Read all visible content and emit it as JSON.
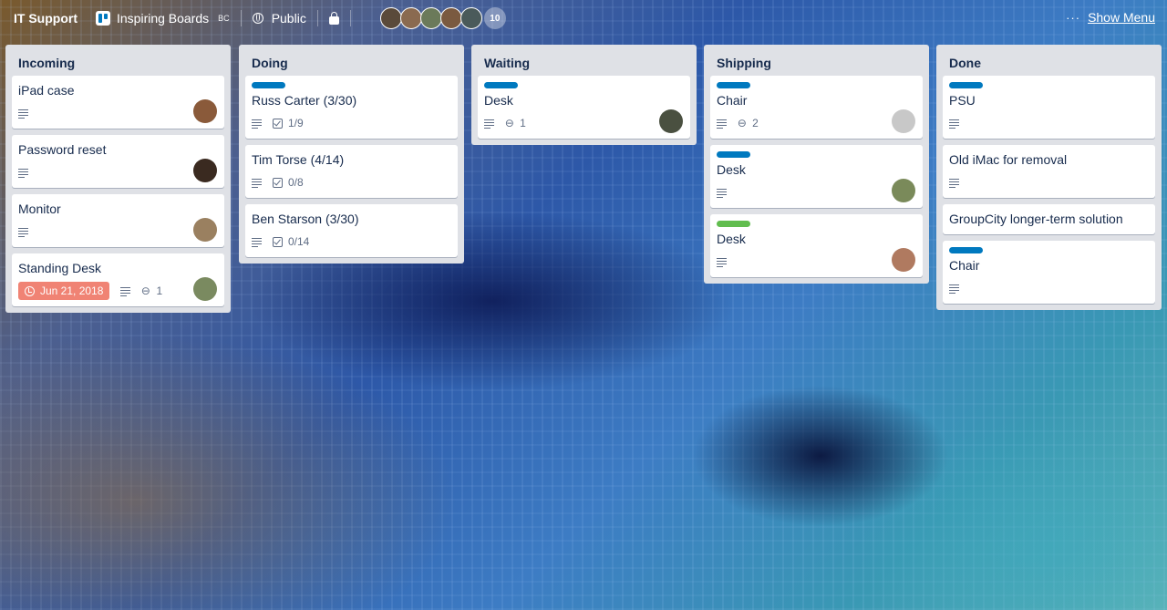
{
  "header": {
    "board_title": "IT Support",
    "org_name": "Inspiring Boards",
    "org_badge": "BC",
    "visibility": "Public",
    "member_count": "10",
    "menu_dots": "···",
    "menu_label": "Show Menu",
    "member_colors": [
      "#5a4a3a",
      "#8a6a50",
      "#6b7a5a",
      "#7a5a40",
      "#4a5a5a"
    ]
  },
  "lists": [
    {
      "name": "Incoming",
      "cards": [
        {
          "title": "iPad case",
          "avatar_color": "#8a5a3a"
        },
        {
          "title": "Password reset",
          "avatar_color": "#3a2a20"
        },
        {
          "title": "Monitor",
          "avatar_color": "#9a8060"
        },
        {
          "title": "Standing Desk",
          "due": "Jun 21, 2018",
          "attachments": "1",
          "avatar_color": "#7a8a60"
        }
      ]
    },
    {
      "name": "Doing",
      "cards": [
        {
          "title": "Russ Carter (3/30)",
          "label_color": "#0079bf",
          "checklist": "1/9"
        },
        {
          "title": "Tim Torse (4/14)",
          "checklist": "0/8"
        },
        {
          "title": "Ben Starson (3/30)",
          "checklist": "0/14"
        }
      ]
    },
    {
      "name": "Waiting",
      "cards": [
        {
          "title": "Desk",
          "label_color": "#0079bf",
          "attachments": "1",
          "avatar_color": "#4a5040"
        }
      ]
    },
    {
      "name": "Shipping",
      "cards": [
        {
          "title": "Chair",
          "label_color": "#0079bf",
          "attachments": "2",
          "avatar_color": "#c8c8c8"
        },
        {
          "title": "Desk",
          "label_color": "#0079bf",
          "avatar_color": "#7a8a5a"
        },
        {
          "title": "Desk",
          "label_color": "#61bd4f",
          "avatar_color": "#b07a60"
        }
      ]
    },
    {
      "name": "Done",
      "cards": [
        {
          "title": "PSU",
          "label_color": "#0079bf"
        },
        {
          "title": "Old iMac for removal"
        },
        {
          "title": "GroupCity longer-term solution"
        },
        {
          "title": "Chair",
          "label_color": "#0079bf"
        }
      ]
    }
  ]
}
